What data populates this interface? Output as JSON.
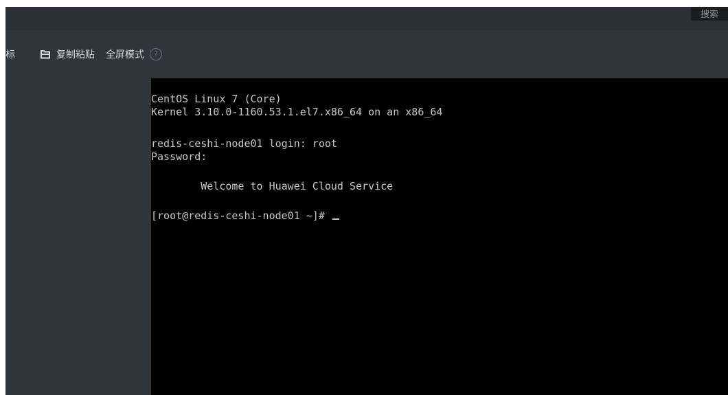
{
  "header": {
    "search_label": "搜索"
  },
  "toolbar": {
    "partial_label": "标",
    "copy_paste_label": "复制粘贴",
    "fullscreen_label": "全屏模式",
    "help_glyph": "?"
  },
  "terminal": {
    "lines": [
      "CentOS Linux 7 (Core)",
      "Kernel 3.10.0-1160.53.1.el7.x86_64 on an x86_64",
      "redis-ceshi-node01 login: root",
      "Password:",
      "        Welcome to Huawei Cloud Service",
      "[root@redis-ceshi-node01 ~]# "
    ]
  },
  "colors": {
    "toolbar_bg": "#30343b",
    "header_bg": "#2c2f36",
    "terminal_bg": "#000000",
    "terminal_text": "#c8c8c8"
  }
}
